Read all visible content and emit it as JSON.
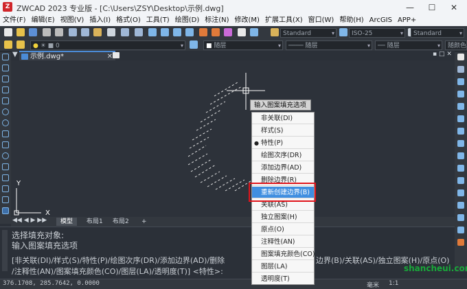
{
  "window": {
    "logo": "Z",
    "title": "ZWCAD 2023 专业版 - [C:\\Users\\ZSY\\Desktop\\示例.dwg]",
    "minimize": "—",
    "maximize": "☐",
    "close": "✕"
  },
  "menu": [
    "文件(F)",
    "编辑(E)",
    "视图(V)",
    "插入(I)",
    "格式(O)",
    "工具(T)",
    "绘图(D)",
    "标注(N)",
    "修改(M)",
    "扩展工具(X)",
    "窗口(W)",
    "帮助(H)",
    "ArcGIS",
    "APP+"
  ],
  "toolbar": {
    "text_style": "Standard",
    "dim_style": "ISO-25",
    "table_style": "Standard",
    "layer_color": "随层",
    "linetype": "随层",
    "lineweight": "随层",
    "plot_color": "随颜色",
    "layer_value": "0"
  },
  "document": {
    "tab_label": "示例.dwg*",
    "tab_icon": "dwg-file-icon"
  },
  "axes": {
    "y": "Y",
    "x": "X"
  },
  "layout_tabs": [
    "模型",
    "布局1",
    "布局2",
    "+"
  ],
  "tooltip": "输入图案填充选项",
  "context_menu": [
    {
      "label": "非关联(DI)",
      "bullet": ""
    },
    {
      "label": "样式(S)",
      "bullet": ""
    },
    {
      "label": "特性(P)",
      "bullet": "●"
    },
    {
      "label": "绘图次序(DR)",
      "bullet": ""
    },
    {
      "label": "添加边界(AD)",
      "bullet": ""
    },
    {
      "label": "删除边界(R)",
      "bullet": ""
    },
    {
      "label": "重新创建边界(B)",
      "bullet": "",
      "highlighted": true
    },
    {
      "label": "关联(AS)",
      "bullet": ""
    },
    {
      "label": "独立图案(H)",
      "bullet": ""
    },
    {
      "label": "原点(O)",
      "bullet": ""
    },
    {
      "label": "注释性(AN)",
      "bullet": ""
    },
    {
      "label": "图案填充颜色(CO)",
      "bullet": ""
    },
    {
      "label": "图层(LA)",
      "bullet": ""
    },
    {
      "label": "透明度(T)",
      "bullet": ""
    }
  ],
  "command": {
    "line1": "选择填充对象:",
    "line2": "输入图案填充选项",
    "options1_left": "[非关联(DI)/样式(S)/特性(P)/绘图次序(DR)/添加边界(AD)/删除",
    "options1_right": "边界(B)/关联(AS)/独立图案(H)/原点(O)",
    "options2": "/注释性(AN)/图案填充颜色(CO)/图层(LA)/透明度(T)] <特性>:"
  },
  "status": {
    "coords": "376.1708, 285.7642, 0.0000",
    "units": "毫米",
    "scale": "1:1"
  },
  "watermark": "shancheui.com",
  "colors": {
    "accent": "#3f8ee0",
    "highlight_border": "#e0141b",
    "canvas": "#2d323a",
    "hatch": "#e6e6e6"
  }
}
